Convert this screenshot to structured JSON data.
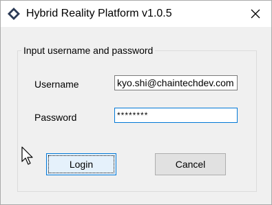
{
  "window": {
    "title": "Hybrid Reality Platform v1.0.5",
    "app_icon": "diamond-logo-icon",
    "close_icon": "close-icon"
  },
  "form": {
    "group_label": "Input username and password",
    "username_label": "Username",
    "username_value": "kyo.shi@chaintechdev.com",
    "password_label": "Password",
    "password_value": "********"
  },
  "buttons": {
    "login": "Login",
    "cancel": "Cancel"
  },
  "colors": {
    "focus_border": "#0078d7",
    "default_button_bg": "#e5f1fb",
    "button_bg": "#e1e1e1",
    "window_bg": "#f0f0f0"
  }
}
